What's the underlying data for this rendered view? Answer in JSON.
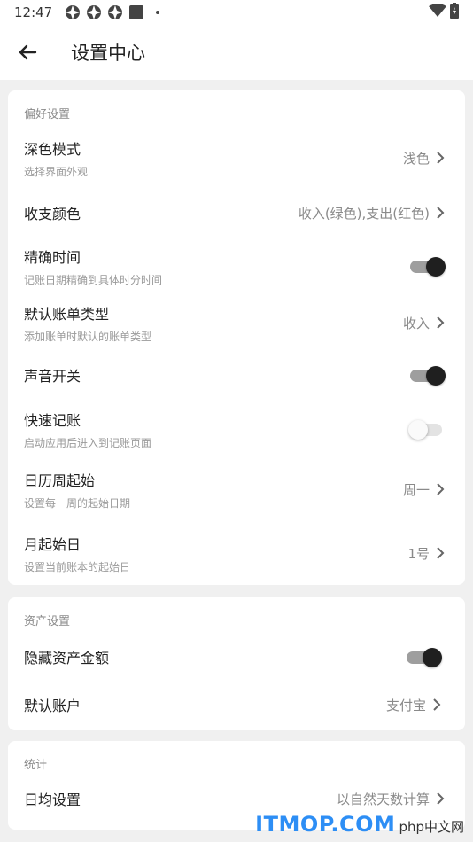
{
  "status_bar": {
    "time": "12:47"
  },
  "header": {
    "title": "设置中心"
  },
  "sections": [
    {
      "title": "偏好设置",
      "rows": [
        {
          "label": "深色模式",
          "sub": "选择界面外观",
          "value": "浅色"
        },
        {
          "label": "收支颜色",
          "value": "收入(绿色),支出(红色)"
        },
        {
          "label": "精确时间",
          "sub": "记账日期精确到具体时分时间",
          "toggle": true
        },
        {
          "label": "默认账单类型",
          "sub": "添加账单时默认的账单类型",
          "value": "收入"
        },
        {
          "label": "声音开关",
          "toggle": true
        },
        {
          "label": "快速记账",
          "sub": "启动应用后进入到记账页面",
          "toggle": false
        },
        {
          "label": "日历周起始",
          "sub": "设置每一周的起始日期",
          "value": "周一"
        },
        {
          "label": "月起始日",
          "sub": "设置当前账本的起始日",
          "value": "1号"
        }
      ]
    },
    {
      "title": "资产设置",
      "rows": [
        {
          "label": "隐藏资产金额",
          "toggle": true
        },
        {
          "label": "默认账户",
          "value": "支付宝"
        }
      ]
    },
    {
      "title": "统计",
      "rows": [
        {
          "label": "日均设置",
          "value": "以自然天数计算"
        }
      ]
    }
  ],
  "watermark": {
    "main": "ITMOP.COM",
    "sub": "php中文网"
  },
  "colors": {
    "toggle_on_thumb": "#1f1f1f",
    "toggle_on_track": "#9e9e9e",
    "toggle_off_track": "#e3e3e3",
    "watermark": "#2d8ef5"
  }
}
